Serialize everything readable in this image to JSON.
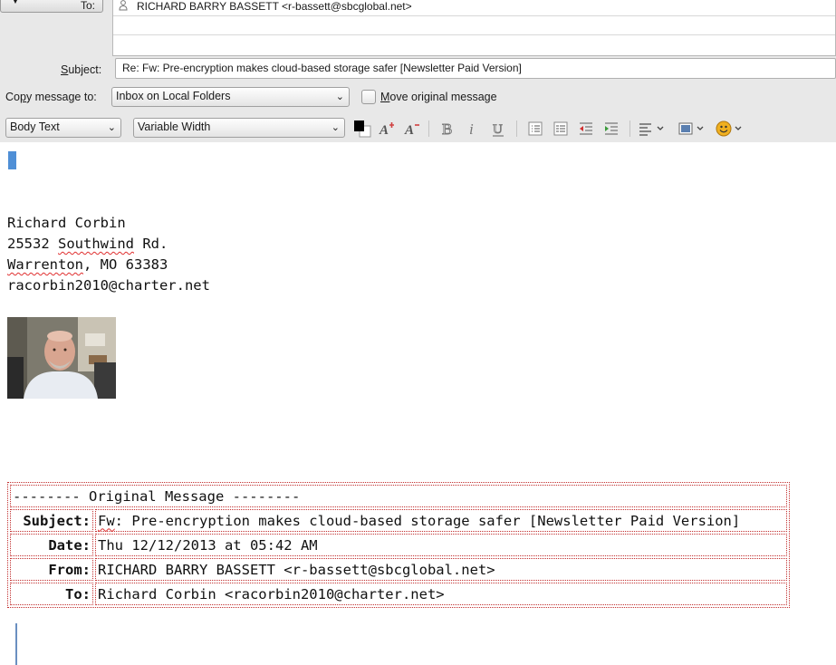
{
  "addressing": {
    "type_label": "To:",
    "recipient": "RICHARD BARRY BASSETT <r-bassett@sbcglobal.net>"
  },
  "subject": {
    "label_prefix": "",
    "label_accel": "S",
    "label_rest": "ubject:",
    "value": "Re: Fw: Pre-encryption makes cloud-based storage safer [Newsletter Paid Version]"
  },
  "copy_message": {
    "label_pre": "Co",
    "label_accel": "p",
    "label_rest": "y message to:",
    "selected": "Inbox on Local Folders",
    "move_pre": "",
    "move_accel": "M",
    "move_rest": "ove original message"
  },
  "format_toolbar": {
    "paragraph_style": "Body Text",
    "font": "Variable Width",
    "icons": [
      "text-color-icon",
      "smaller-font-icon",
      "larger-font-icon",
      "bold-icon",
      "italic-icon",
      "underline-icon",
      "bullet-list-icon",
      "numbered-list-icon",
      "outdent-icon",
      "indent-icon",
      "align-icon",
      "insert-image-icon",
      "emoticon-icon"
    ]
  },
  "signature": {
    "name": "Richard Corbin",
    "street_num": "25532 ",
    "street_name": "Southwind",
    "street_suffix": " Rd.",
    "city": "Warrenton",
    "state_zip": ", MO 63383",
    "email": "racorbin2010@charter.net"
  },
  "original_message": {
    "header": "-------- Original Message --------",
    "rows": [
      {
        "label": "Subject:",
        "value_prefix": "Fw",
        "value_rest": ": Pre-encryption makes cloud-based storage safer [Newsletter Paid Version]"
      },
      {
        "label": "Date:",
        "value_prefix": "",
        "value_rest": "Thu 12/12/2013 at 05:42 AM"
      },
      {
        "label": "From:",
        "value_prefix": "",
        "value_rest": "RICHARD BARRY BASSETT <r-bassett@sbcglobal.net>"
      },
      {
        "label": "To:",
        "value_prefix": "",
        "value_rest": "Richard Corbin <racorbin2010@charter.net>"
      }
    ]
  },
  "colors": {
    "accent_caret": "#4f8fd6",
    "table_border": "#c23030",
    "spell_underline": "#e03030"
  }
}
